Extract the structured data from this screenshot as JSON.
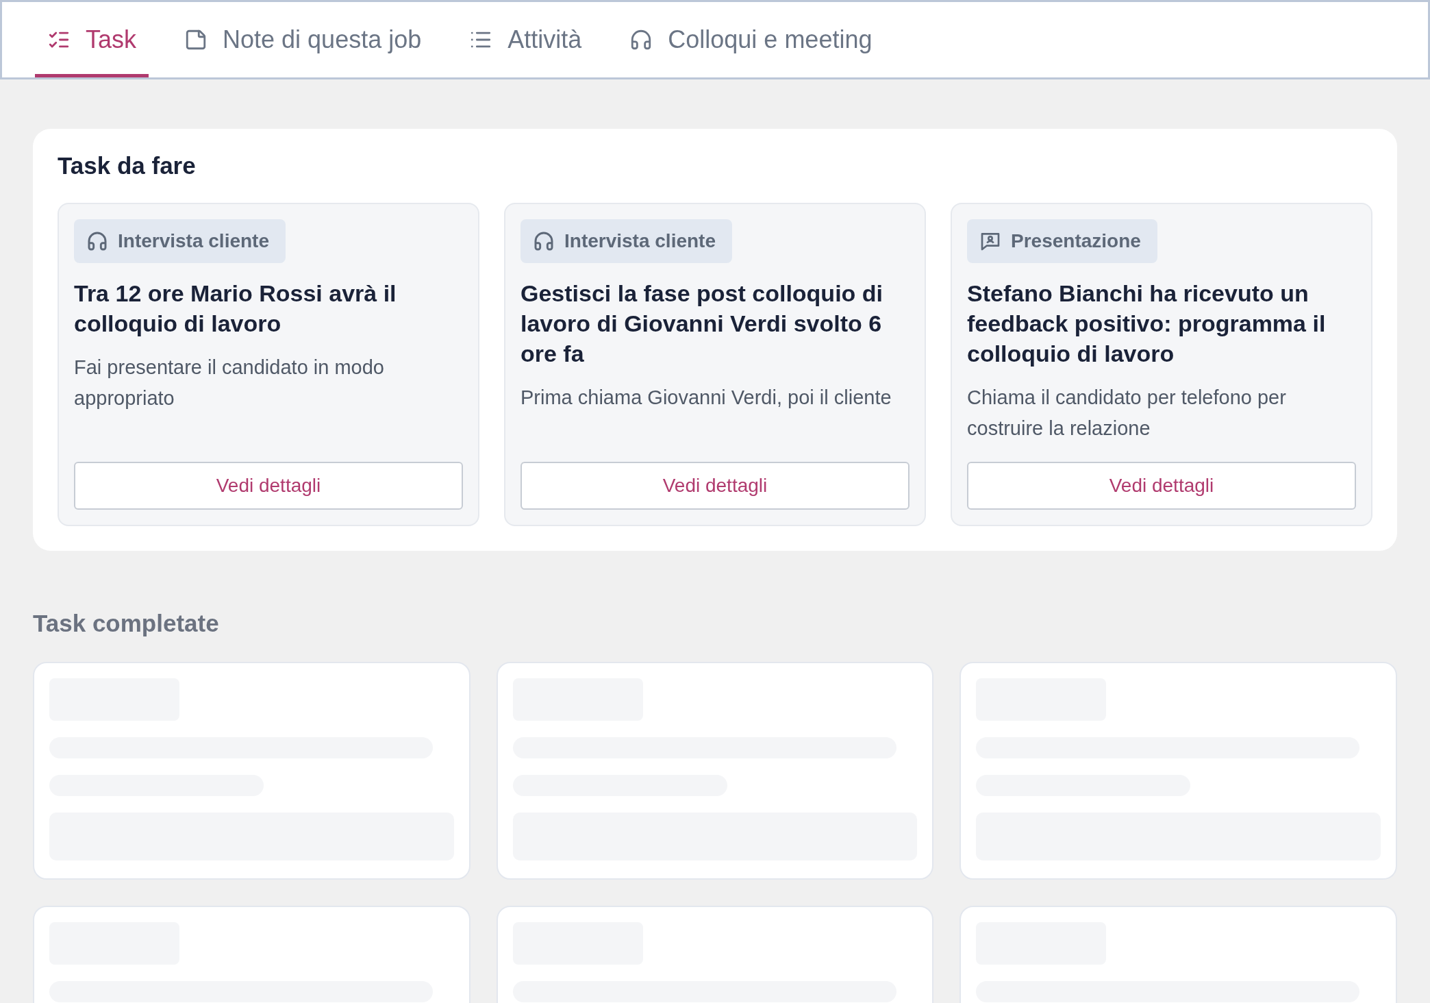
{
  "tabs": [
    {
      "label": "Task",
      "kind": "tasks",
      "selected": true
    },
    {
      "label": "Note di questa job",
      "kind": "notes",
      "selected": false
    },
    {
      "label": "Attività",
      "kind": "activity",
      "selected": false
    },
    {
      "label": "Colloqui e meeting",
      "kind": "meetings",
      "selected": false
    }
  ],
  "todo": {
    "title": "Task da fare",
    "cards": [
      {
        "badge": {
          "label": "Intervista cliente",
          "kind": "interview"
        },
        "title": "Tra 12 ore Mario Rossi avrà il colloquio di lavoro",
        "description": "Fai presentare il candidato in modo appropriato",
        "button": "Vedi dettagli"
      },
      {
        "badge": {
          "label": "Intervista cliente",
          "kind": "interview"
        },
        "title": "Gestisci la fase post colloquio di lavoro di Giovanni Verdi svolto 6 ore fa",
        "description": "Prima chiama Giovanni Verdi, poi il cliente",
        "button": "Vedi dettagli"
      },
      {
        "badge": {
          "label": "Presentazione",
          "kind": "presentation"
        },
        "title": "Stefano Bianchi ha ricevuto un feedback positivo: programma il colloquio di lavoro",
        "description": "Chiama il candidato per telefono per costruire la relazione",
        "button": "Vedi dettagli"
      }
    ]
  },
  "completed": {
    "title": "Task completate",
    "cards": [
      {
        "kind": "skeleton"
      },
      {
        "kind": "skeleton"
      },
      {
        "kind": "skeleton"
      },
      {
        "kind": "partial"
      },
      {
        "kind": "partial"
      },
      {
        "kind": "partial"
      }
    ]
  }
}
